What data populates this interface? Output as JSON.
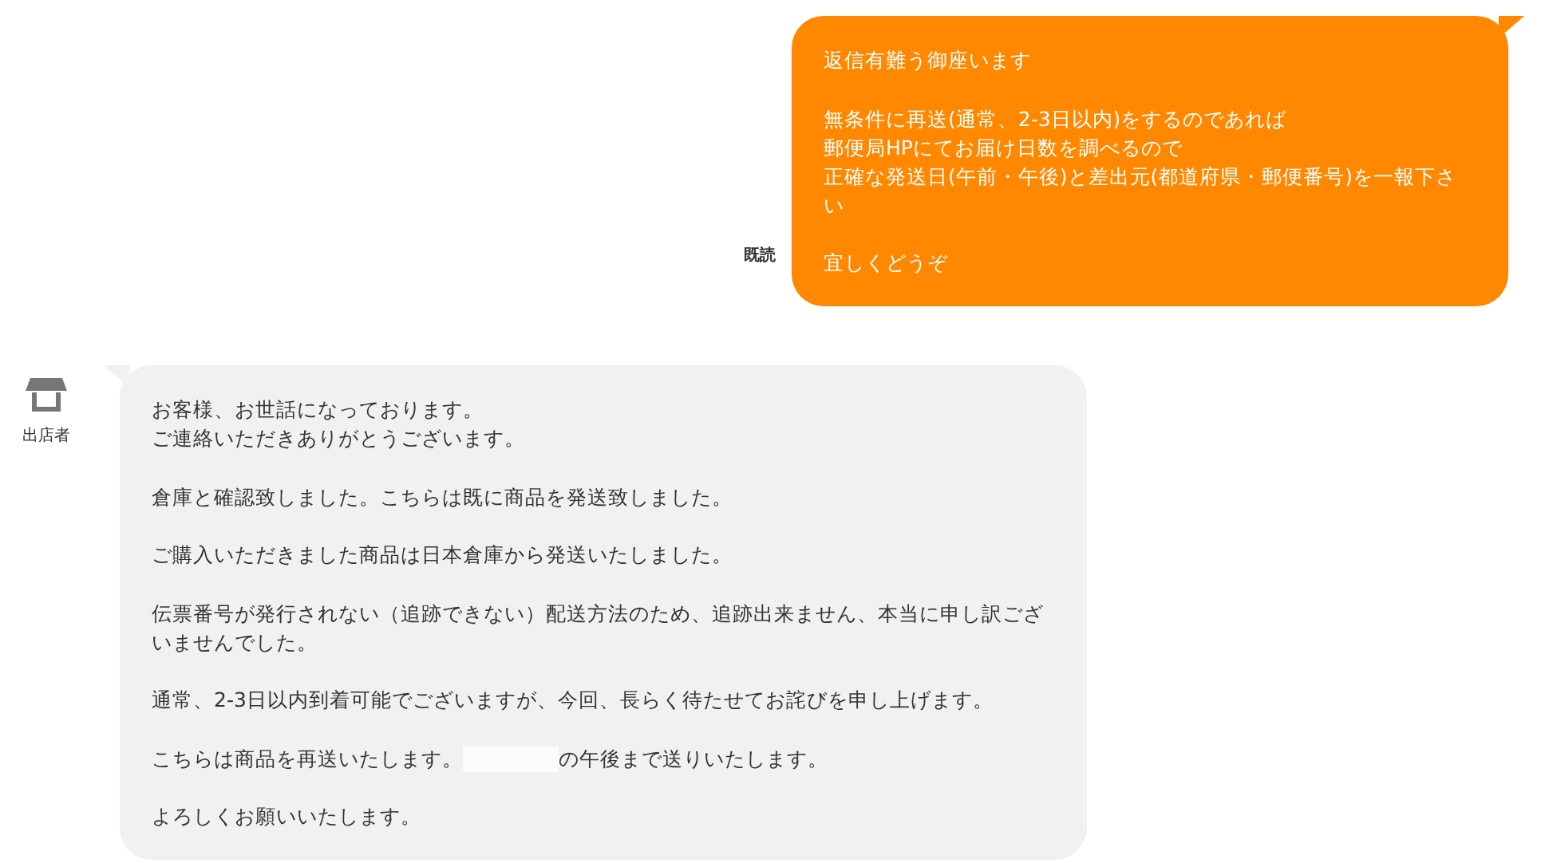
{
  "messages": [
    {
      "kind": "outgoing",
      "read_label": "既読",
      "paragraphs": [
        [
          "返信有難う御座います"
        ],
        [
          "無条件に再送(通常、2-3日以内)をするのであれば",
          "郵便局HPにてお届け日数を調べるので",
          "正確な発送日(午前・午後)と差出元(都道府県・郵便番号)を一報下さい"
        ],
        [
          "宜しくどうぞ"
        ]
      ]
    },
    {
      "kind": "incoming",
      "sender": "出店者",
      "paragraphs": [
        [
          "お客様、お世話になっております。",
          "ご連絡いただきありがとうございます。"
        ],
        [
          "倉庫と確認致しました。こちらは既に商品を発送致しました。"
        ],
        [
          "ご購入いただきました商品は日本倉庫から発送いたしました。"
        ],
        [
          "伝票番号が発行されない（追跡できない）配送方法のため、追跡出来ません、本当に申し訳ございませんでした。"
        ],
        [
          "通常、2-3日以内到着可能でございますが、今回、長らく待たせてお詫びを申し上げます。"
        ],
        [
          "こちらは商品を再送いたします。",
          "の午後まで送りいたします。"
        ],
        [
          "よろしくお願いいたします。"
        ]
      ]
    }
  ]
}
